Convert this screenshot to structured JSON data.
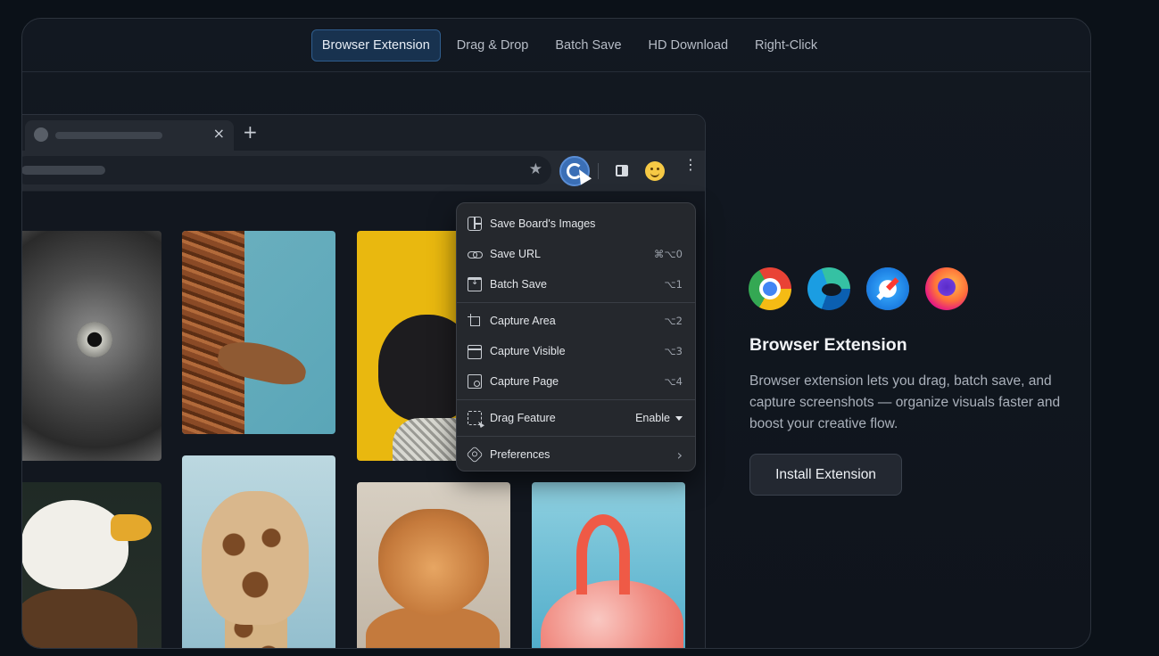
{
  "tabs": [
    {
      "label": "Browser Extension",
      "active": true
    },
    {
      "label": "Drag & Drop",
      "active": false
    },
    {
      "label": "Batch Save",
      "active": false
    },
    {
      "label": "HD Download",
      "active": false
    },
    {
      "label": "Right-Click",
      "active": false
    }
  ],
  "browser": {
    "close_glyph": "×",
    "new_tab_glyph": "+",
    "star_glyph": "★",
    "kebab_glyph": "⋮"
  },
  "menu": {
    "items": [
      {
        "label": "Save Board's Images",
        "shortcut": "",
        "icon": "board-icon"
      },
      {
        "label": "Save URL",
        "shortcut": "⌘⌥0",
        "icon": "link-icon"
      },
      {
        "label": "Batch Save",
        "shortcut": "⌥1",
        "icon": "batch-save-icon"
      },
      {
        "label": "Capture Area",
        "shortcut": "⌥2",
        "icon": "crop-icon"
      },
      {
        "label": "Capture Visible",
        "shortcut": "⌥3",
        "icon": "window-icon"
      },
      {
        "label": "Capture Page",
        "shortcut": "⌥4",
        "icon": "page-capture-icon"
      },
      {
        "label": "Drag Feature",
        "value": "Enable",
        "icon": "drag-icon"
      },
      {
        "label": "Preferences",
        "chevron": "›",
        "icon": "gear-icon"
      }
    ]
  },
  "feature": {
    "title": "Browser Extension",
    "description": "Browser extension lets you drag, batch save, and capture screenshots — organize visuals faster and boost your creative flow.",
    "install_label": "Install Extension",
    "browsers": [
      "chrome-icon",
      "edge-icon",
      "safari-icon",
      "firefox-icon"
    ]
  },
  "colors": {
    "accent": "#18324f",
    "background": "#0b1118"
  }
}
